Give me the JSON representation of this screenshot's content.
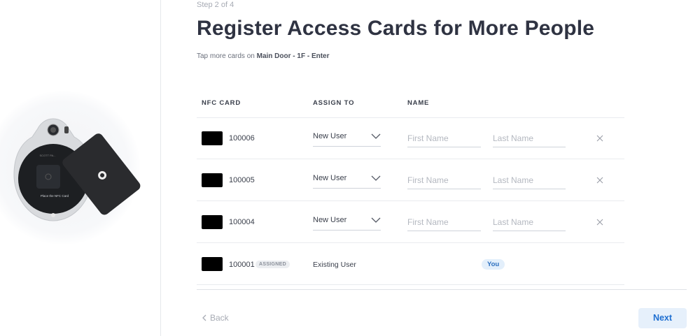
{
  "step_label": "Step 2 of 4",
  "title": "Register Access Cards for More People",
  "subtitle": {
    "prefix": "Tap more cards on ",
    "location": "Main Door - 1F - Enter"
  },
  "illustration": {
    "device_text": "Place the NFC Card",
    "brand_text": "SCOTT PA..."
  },
  "table": {
    "headers": {
      "nfc_card": "NFC CARD",
      "assign_to": "ASSIGN TO",
      "name": "NAME"
    },
    "rows": [
      {
        "card_id": "100006",
        "assign": "New User",
        "first_name_placeholder": "First Name",
        "last_name_placeholder": "Last Name"
      },
      {
        "card_id": "100005",
        "assign": "New User",
        "first_name_placeholder": "First Name",
        "last_name_placeholder": "Last Name"
      },
      {
        "card_id": "100004",
        "assign": "New User",
        "first_name_placeholder": "First Name",
        "last_name_placeholder": "Last Name"
      }
    ],
    "assigned_row": {
      "card_id": "100001",
      "badge": "ASSIGNED",
      "assign": "Existing User",
      "name_badge": "You"
    }
  },
  "footer": {
    "back_label": "Back",
    "next_label": "Next"
  },
  "colors": {
    "accent": "#1f6fd1",
    "accent_bg": "#e6f0fb",
    "text": "#2d3140",
    "muted": "#a7abb4"
  },
  "icons": {
    "back": "chevron-left-icon",
    "dropdown": "chevron-down-icon",
    "remove": "close-icon"
  }
}
